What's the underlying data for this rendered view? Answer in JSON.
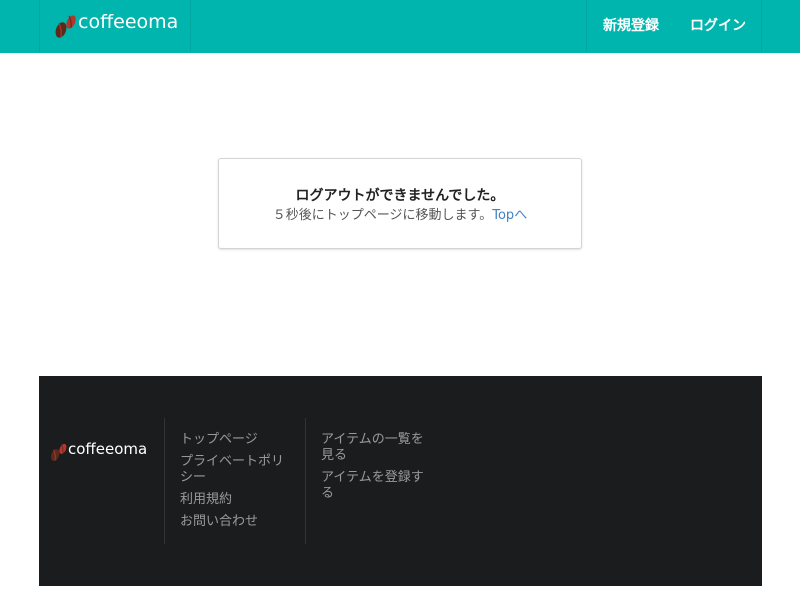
{
  "header": {
    "logo_text": "coffeeoma",
    "nav": {
      "signup_label": "新規登録",
      "login_label": "ログイン"
    }
  },
  "message": {
    "title": "ログアウトができませんでした。",
    "subtitle": "５秒後にトップページに移動します。",
    "link_label": "Topへ"
  },
  "footer": {
    "logo_text": "coffeeoma",
    "col1": [
      "トップページ",
      "プライベートポリシー",
      "利用規約",
      "お問い合わせ"
    ],
    "col2": [
      "アイテムの一覧を見る",
      "アイテムを登録する"
    ]
  },
  "colors": {
    "header_bg": "#00b5ad",
    "footer_bg": "#1b1c1d",
    "link": "#4183c4",
    "bean_dark": "#5a2a1c",
    "bean_red": "#b2362b"
  }
}
